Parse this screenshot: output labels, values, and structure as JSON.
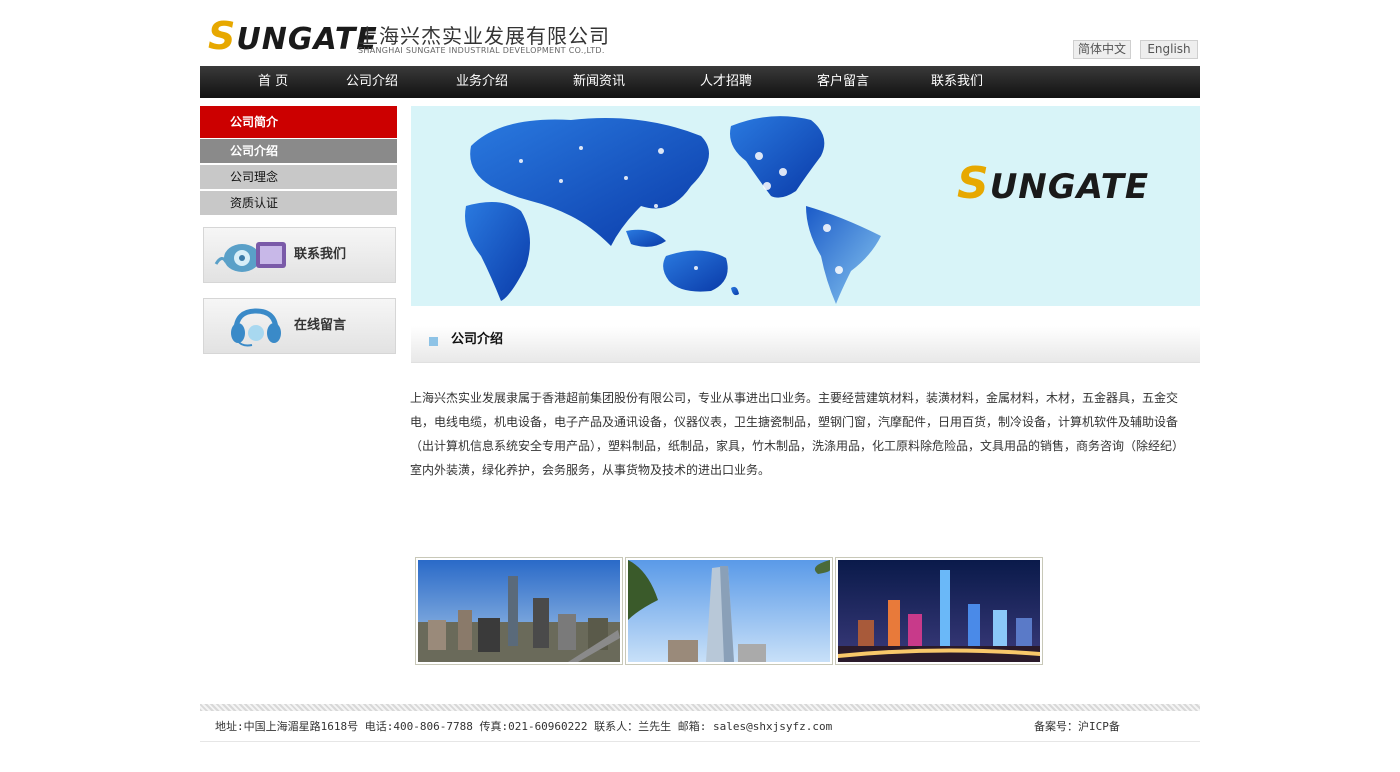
{
  "header": {
    "logo_mark": "UNGATE",
    "logo_s": "S",
    "company_cn": "上海兴杰实业发展有限公司",
    "company_en": "SHANGHAI SUNGATE INDUSTRIAL DEVELOPMENT CO.,LTD.",
    "lang_cn": "简体中文",
    "lang_en": "English"
  },
  "nav": {
    "items": [
      "首 页",
      "公司介绍",
      "业务介绍",
      "新闻资讯",
      "人才招聘",
      "客户留言",
      "联系我们"
    ]
  },
  "sidebar": {
    "heading": "公司简介",
    "items": [
      {
        "label": "公司介绍",
        "active": true
      },
      {
        "label": "公司理念",
        "active": false
      },
      {
        "label": "资质认证",
        "active": false
      }
    ],
    "contact_label": "联系我们",
    "message_label": "在线留言"
  },
  "banner": {
    "logo_s": "S",
    "logo_mark": "UNGATE"
  },
  "section": {
    "title": "公司介绍",
    "body": "上海兴杰实业发展隶属于香港超前集团股份有限公司，专业从事进出口业务。主要经营建筑材料，装潢材料，金属材料，木材，五金器具，五金交电，电线电缆，机电设备，电子产品及通讯设备，仪器仪表，卫生搪瓷制品，塑钢门窗，汽摩配件，日用百货，制冷设备，计算机软件及辅助设备（出计算机信息系统安全专用产品），塑料制品，纸制品，家具，竹木制品，洗涤用品，化工原料除危险品，文具用品的销售，商务咨询（除经纪）室内外装潢，绿化养护，会务服务，从事货物及技术的进出口业务。"
  },
  "footer": {
    "address": "地址:中国上海湄星路1618号 电话:400-806-7788   传真:021-60960222 联系人：兰先生 邮箱: sales@shxjsyfz.com",
    "icp": "备案号：沪ICP备"
  },
  "colors": {
    "nav_bg": "#1a1a1a",
    "side_heading": "#cc0000",
    "accent_yellow": "#e7a800",
    "banner_bg": "#d8f4f8"
  }
}
